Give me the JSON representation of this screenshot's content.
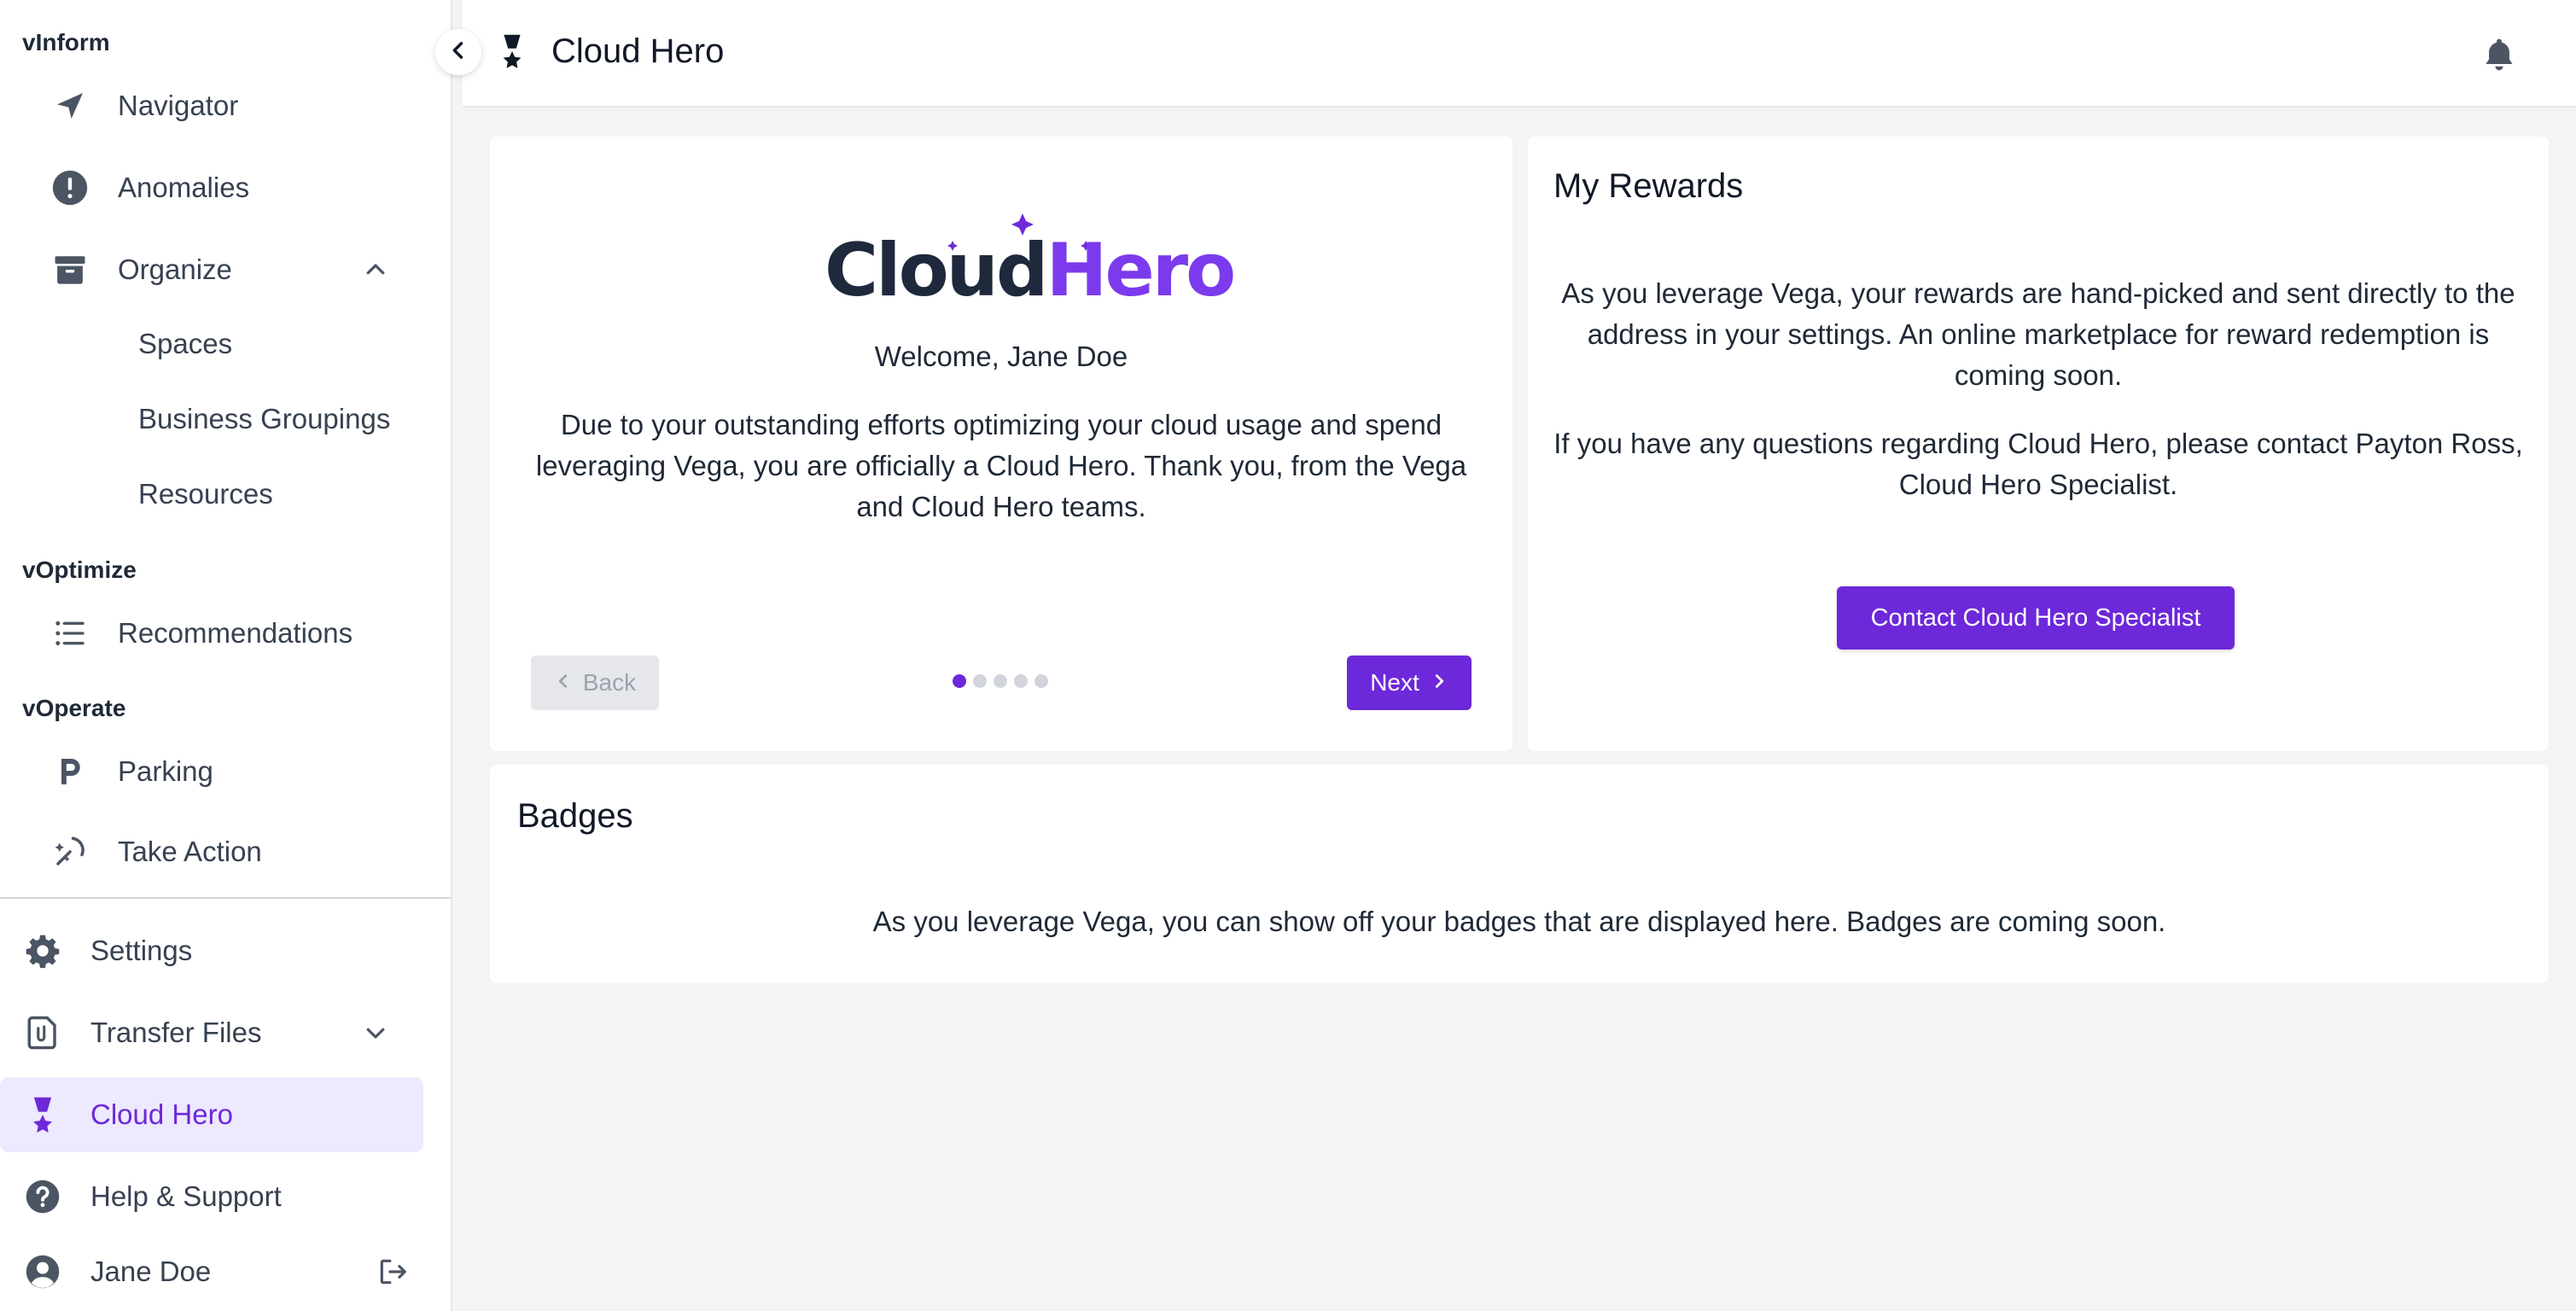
{
  "colors": {
    "accent": "#6d28d9",
    "active_bg": "#ede9fe",
    "page_bg": "#f3f4f6"
  },
  "sidebar": {
    "sections": {
      "vinform": "vInform",
      "voptimize": "vOptimize",
      "voperate": "vOperate"
    },
    "items": {
      "navigator": {
        "label": "Navigator",
        "icon": "paper-plane-icon"
      },
      "anomalies": {
        "label": "Anomalies",
        "icon": "exclamation-circle-icon"
      },
      "organize": {
        "label": "Organize",
        "icon": "archive-box-icon",
        "expanded": true
      },
      "spaces": {
        "label": "Spaces"
      },
      "business_groupings": {
        "label": "Business Groupings"
      },
      "resources": {
        "label": "Resources"
      },
      "recommendations": {
        "label": "Recommendations",
        "icon": "list-icon"
      },
      "parking": {
        "label": "Parking",
        "icon": "parking-p-icon"
      },
      "take_action": {
        "label": "Take Action",
        "icon": "sparkle-action-icon"
      }
    },
    "bottom": {
      "settings": {
        "label": "Settings",
        "icon": "gear-icon"
      },
      "transfer_files": {
        "label": "Transfer Files",
        "icon": "paperclip-document-icon"
      },
      "cloud_hero": {
        "label": "Cloud Hero",
        "icon": "medal-icon",
        "active": true
      },
      "help": {
        "label": "Help & Support",
        "icon": "question-circle-icon"
      },
      "user": {
        "label": "Jane Doe",
        "icon": "user-avatar-icon"
      }
    }
  },
  "header": {
    "title": "Cloud Hero"
  },
  "hero_card": {
    "logo_dark": "Cloud",
    "logo_accent": "Hero",
    "welcome": "Welcome, Jane Doe",
    "message": "Due to your outstanding efforts optimizing your cloud usage and spend leveraging Vega, you are officially a Cloud Hero. Thank you, from the Vega and Cloud Hero teams.",
    "back_label": "Back",
    "next_label": "Next",
    "pages_total": 5,
    "current_page": 1
  },
  "rewards_card": {
    "title": "My Rewards",
    "paragraph1": "As you leverage Vega, your rewards are hand-picked and sent directly to the address in your settings. An online marketplace for reward redemption is coming soon.",
    "paragraph2": "If you have any questions regarding Cloud Hero, please contact Payton Ross, Cloud Hero Specialist.",
    "contact_button": "Contact Cloud Hero Specialist"
  },
  "badges_card": {
    "title": "Badges",
    "message": "As you leverage Vega, you can show off your badges that are displayed here. Badges are coming soon."
  }
}
